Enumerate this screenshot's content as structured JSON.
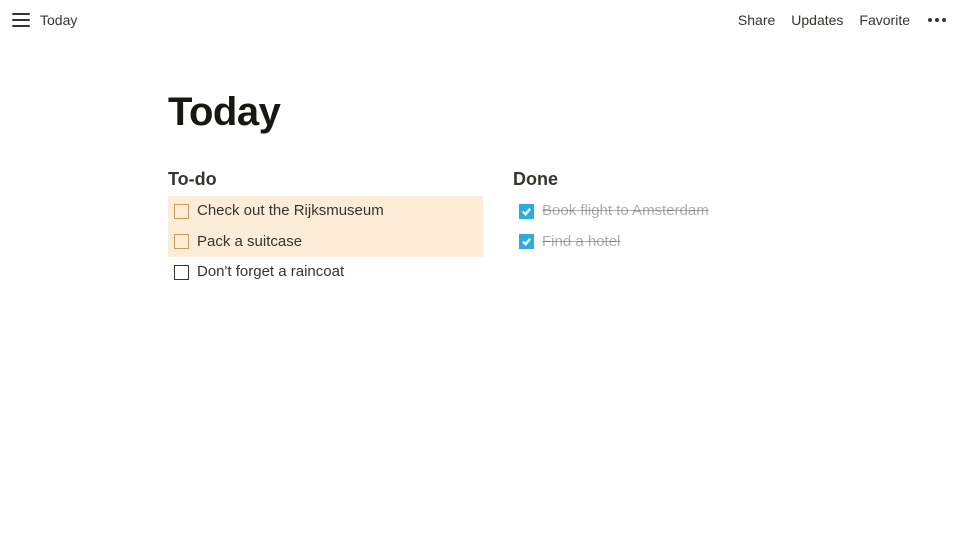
{
  "topbar": {
    "breadcrumb": "Today",
    "actions": {
      "share": "Share",
      "updates": "Updates",
      "favorite": "Favorite"
    }
  },
  "page": {
    "title": "Today"
  },
  "columns": {
    "todo": {
      "heading": "To-do",
      "items": [
        {
          "text": "Check out the Rijksmuseum",
          "checked": false,
          "highlight": true
        },
        {
          "text": "Pack a suitcase",
          "checked": false,
          "highlight": true
        },
        {
          "text": "Don't forget a raincoat",
          "checked": false,
          "highlight": false
        }
      ]
    },
    "done": {
      "heading": "Done",
      "items": [
        {
          "text": "Book flight to Amsterdam",
          "checked": true
        },
        {
          "text": "Find a hotel",
          "checked": true
        }
      ]
    }
  }
}
